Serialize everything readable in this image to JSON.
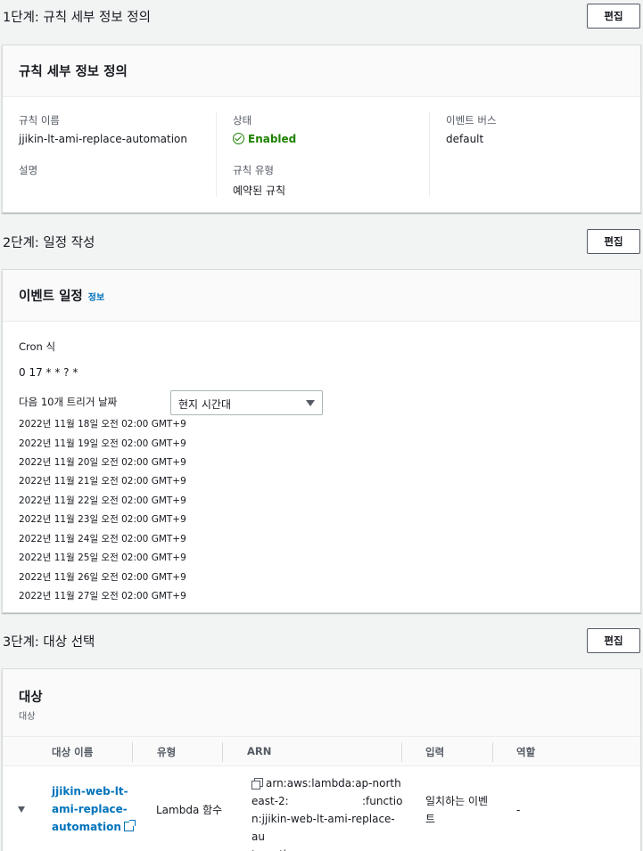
{
  "step1": {
    "title": "1단계: 규칙 세부 정보 정의",
    "edit_label": "편집",
    "card_title": "규칙 세부 정보 정의",
    "rule_name_label": "규칙 이름",
    "rule_name_value": "jjikin-lt-ami-replace-automation",
    "description_label": "설명",
    "status_label": "상태",
    "status_value": "Enabled",
    "rule_type_label": "규칙 유형",
    "rule_type_value": "예약된 규칙",
    "event_bus_label": "이벤트 버스",
    "event_bus_value": "default",
    "status_color": "#1d8102"
  },
  "step2": {
    "title": "2단계: 일정 작성",
    "edit_label": "편집",
    "card_title": "이벤트 일정",
    "info_link": "정보",
    "cron_label": "Cron 식",
    "cron_value": "0 17 * * ? *",
    "next_triggers_label": "다음 10개 트리거 날짜",
    "timezone_select": "현지 시간대",
    "dates": [
      "2022년 11월 18일 오전 02:00 GMT+9",
      "2022년 11월 19일 오전 02:00 GMT+9",
      "2022년 11월 20일 오전 02:00 GMT+9",
      "2022년 11월 21일 오전 02:00 GMT+9",
      "2022년 11월 22일 오전 02:00 GMT+9",
      "2022년 11월 23일 오전 02:00 GMT+9",
      "2022년 11월 24일 오전 02:00 GMT+9",
      "2022년 11월 25일 오전 02:00 GMT+9",
      "2022년 11월 26일 오전 02:00 GMT+9",
      "2022년 11월 27일 오전 02:00 GMT+9"
    ]
  },
  "step3": {
    "title": "3단계: 대상 선택",
    "edit_label": "편집",
    "card_title": "대상",
    "card_subtitle": "대상",
    "columns": [
      "대상 이름",
      "유형",
      "ARN",
      "입력",
      "역할"
    ],
    "row": {
      "name_lines": [
        "jjikin-web-lt-",
        "ami-replace-",
        "automation"
      ],
      "type": "Lambda 함수",
      "arn_lines": [
        "arn:aws:lambda:ap-north",
        "east-2:",
        ":functio",
        "n:jjikin-web-lt-ami-replace-au",
        "tomation"
      ],
      "input_lines": [
        "일치하는 이벤",
        "트"
      ],
      "role": "-"
    },
    "link_color": "#0073bb"
  }
}
